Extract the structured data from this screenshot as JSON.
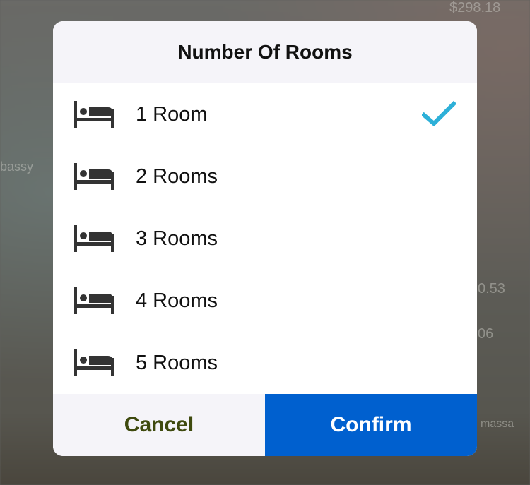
{
  "background": {
    "texts": [
      "$298.18",
      "bassy",
      "0.53",
      "06",
      "massa"
    ]
  },
  "dialog": {
    "title": "Number Of Rooms",
    "options": [
      {
        "label": "1 Room",
        "icon": "bed-icon",
        "selected": true
      },
      {
        "label": "2 Rooms",
        "icon": "bed-icon",
        "selected": false
      },
      {
        "label": "3 Rooms",
        "icon": "bed-icon",
        "selected": false
      },
      {
        "label": "4 Rooms",
        "icon": "bed-icon",
        "selected": false
      },
      {
        "label": "5 Rooms",
        "icon": "bed-icon",
        "selected": false
      }
    ],
    "selected_icon": "checkmark-icon",
    "cancel_label": "Cancel",
    "confirm_label": "Confirm"
  },
  "colors": {
    "cancel_text": "#3f4a0f",
    "confirm_bg": "#0060cf",
    "checkmark": "#2db0d8",
    "icon": "#333333"
  }
}
